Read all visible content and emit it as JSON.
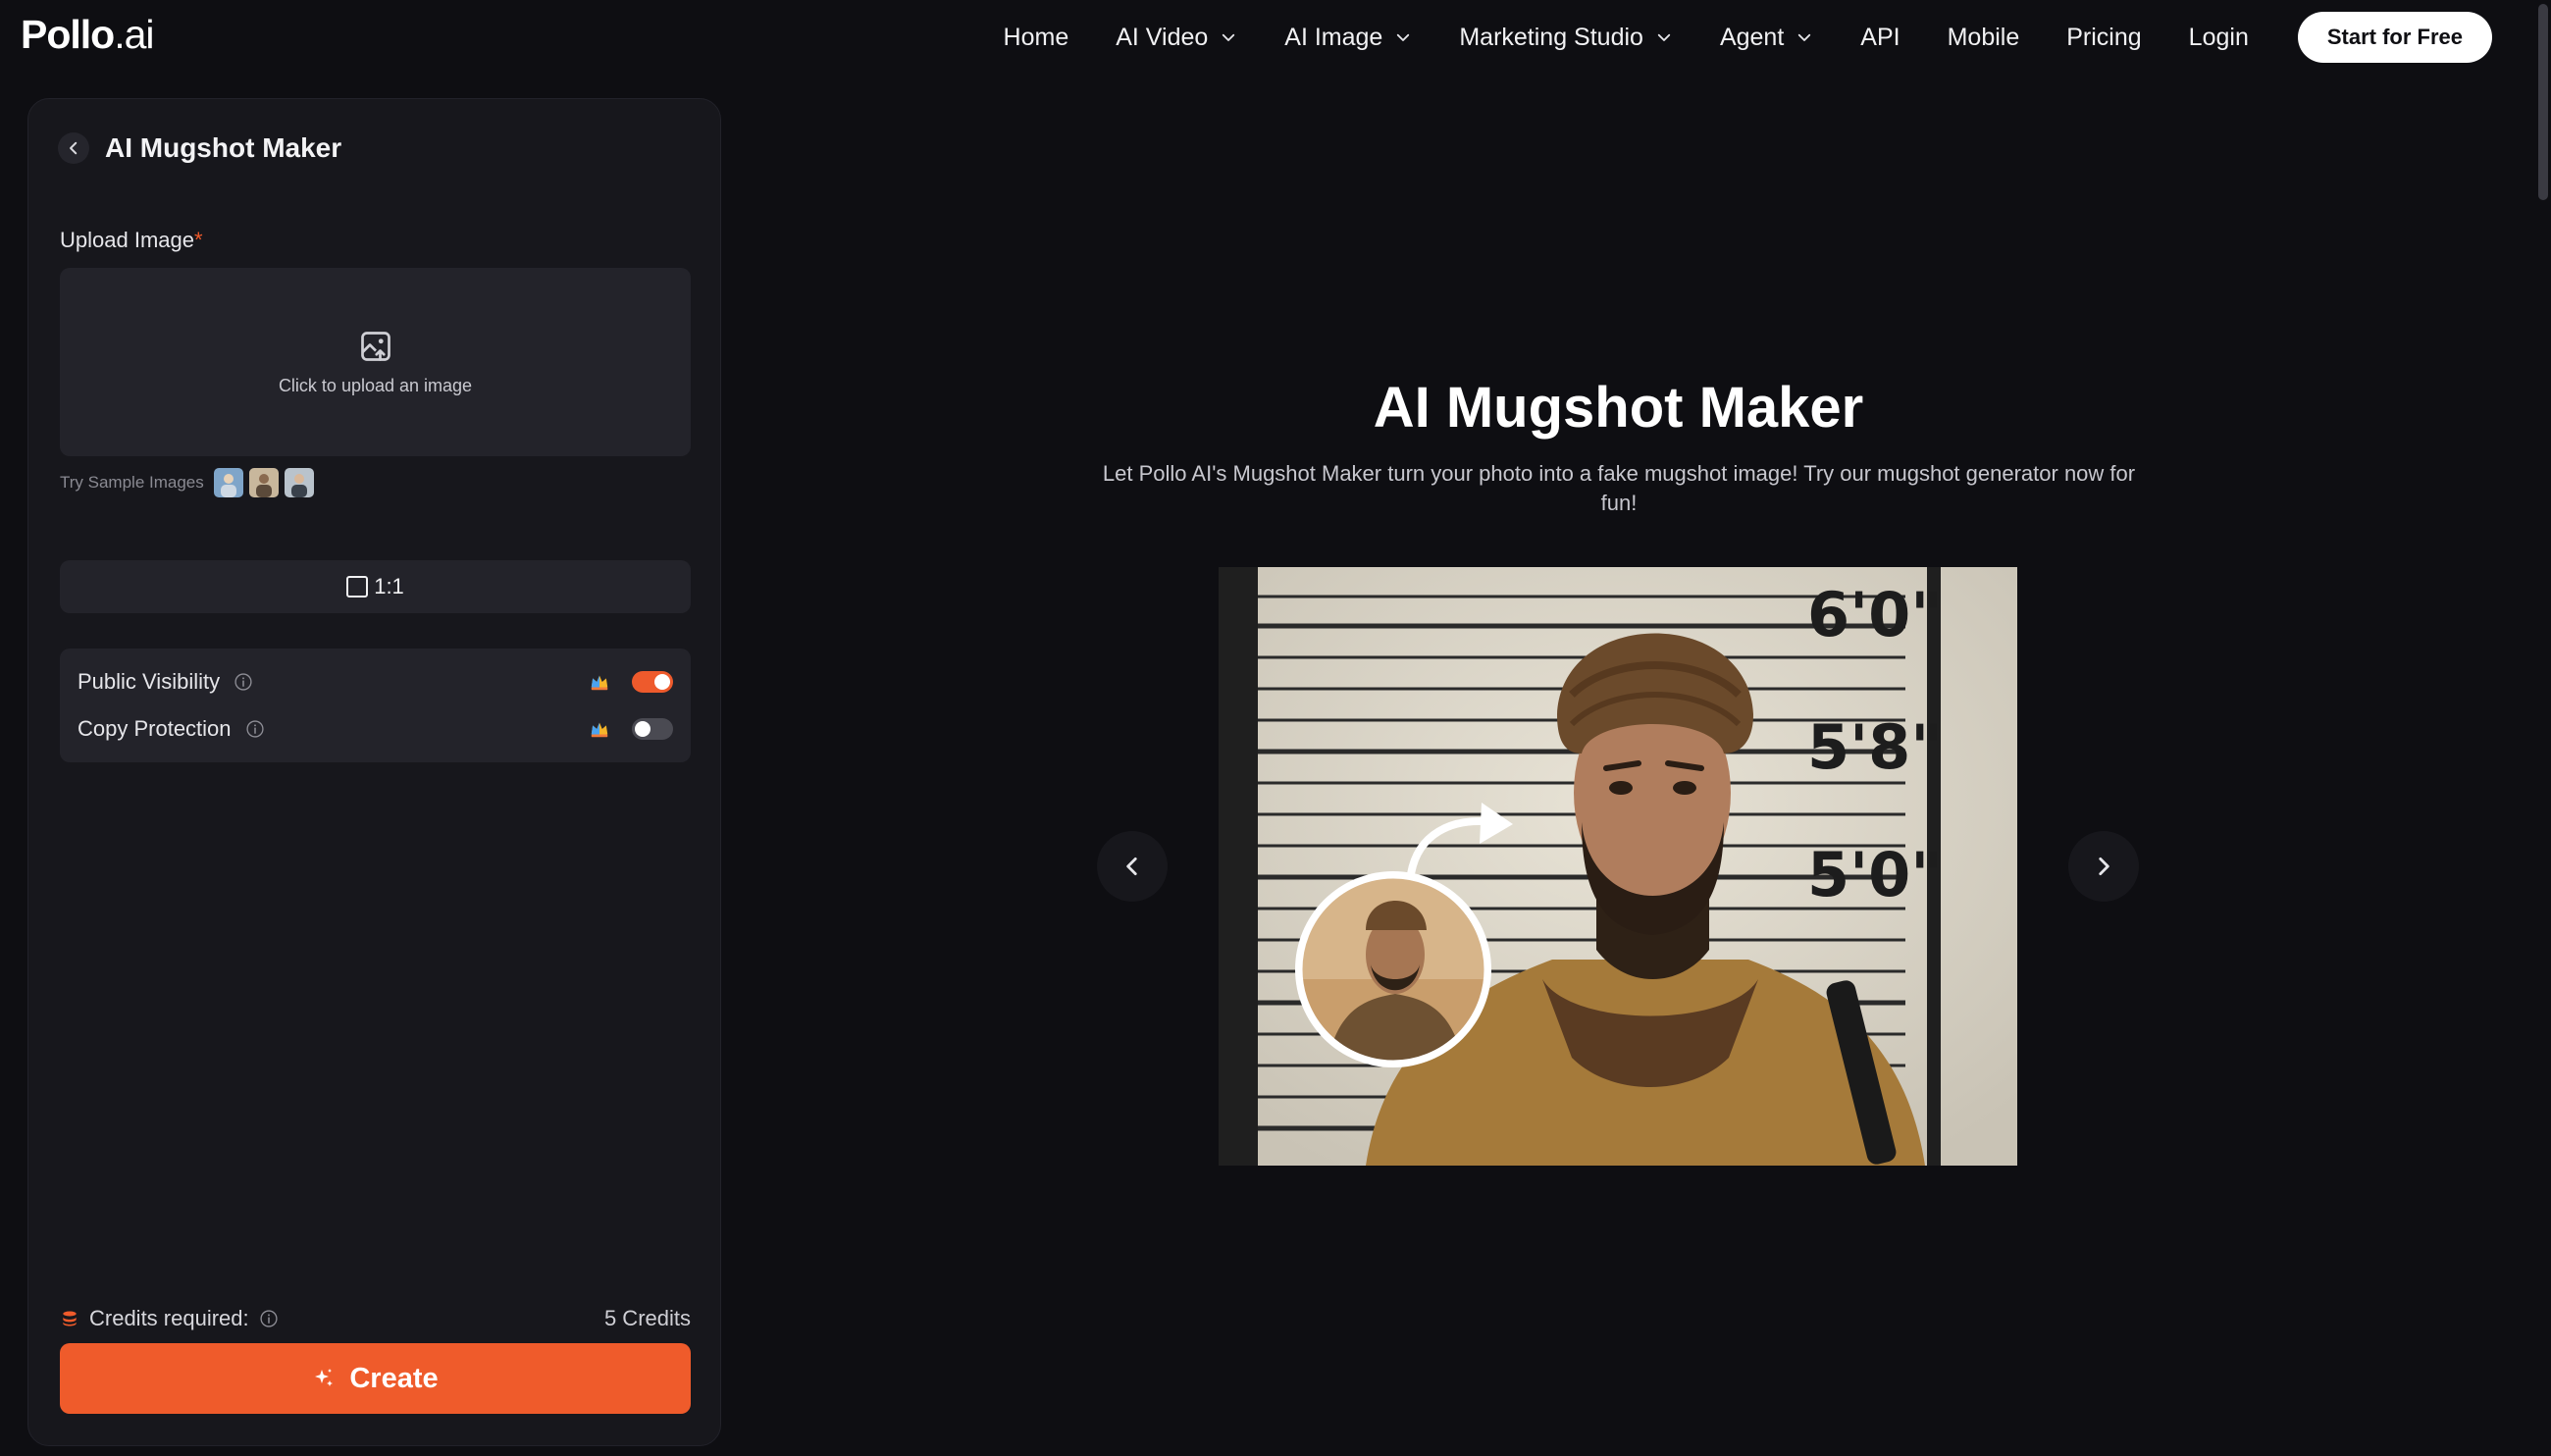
{
  "brand": {
    "name": "Pollo",
    "suffix": ".ai"
  },
  "nav": {
    "items": [
      {
        "label": "Home"
      },
      {
        "label": "AI Video"
      },
      {
        "label": "AI Image"
      },
      {
        "label": "Marketing Studio"
      },
      {
        "label": "Agent"
      },
      {
        "label": "API"
      },
      {
        "label": "Mobile"
      },
      {
        "label": "Pricing"
      },
      {
        "label": "Login"
      }
    ],
    "cta": "Start for Free"
  },
  "panel": {
    "title": "AI Mugshot Maker",
    "upload_label": "Upload Image",
    "required_mark": "*",
    "upload_hint": "Click to upload an image",
    "samples_label": "Try Sample Images",
    "aspect_ratio": "1:1",
    "toggles": [
      {
        "label": "Public Visibility",
        "on": true
      },
      {
        "label": "Copy Protection",
        "on": false
      }
    ],
    "credits_label": "Credits required:",
    "credits_value": "5 Credits",
    "create_label": "Create"
  },
  "hero": {
    "title": "AI Mugshot Maker",
    "subtitle": "Let Pollo AI's Mugshot Maker turn your photo into a fake mugshot image! Try our mugshot generator now for fun!",
    "height_marks": [
      "6'0\"",
      "5'8\"",
      "5'0\""
    ]
  },
  "colors": {
    "accent": "#ef5b2b",
    "background": "#0e0e12",
    "panel": "#17171c",
    "field": "#23232a"
  }
}
